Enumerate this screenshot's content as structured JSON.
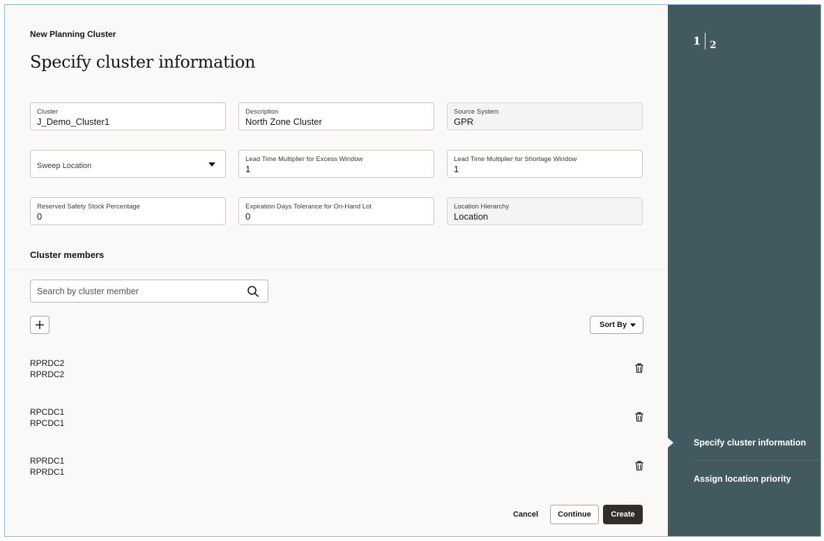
{
  "header": {
    "eyebrow": "New Planning Cluster",
    "title": "Specify cluster information"
  },
  "fields": {
    "cluster": {
      "label": "Cluster",
      "value": "J_Demo_Cluster1"
    },
    "description": {
      "label": "Description",
      "value": "North Zone Cluster"
    },
    "source_system": {
      "label": "Source System",
      "value": "GPR"
    },
    "sweep_location": {
      "placeholder": "Sweep Location"
    },
    "lead_excess": {
      "label": "Lead Time Multiplier for Excess Window",
      "value": "1"
    },
    "lead_shortage": {
      "label": "Lead Time Multiplier for Shortage Window",
      "value": "1"
    },
    "reserved_safety": {
      "label": "Reserved Safety Stock Percentage",
      "value": "0"
    },
    "expiration_tolerance": {
      "label": "Expiration Days Tolerance for On-Hand Lot",
      "value": "0"
    },
    "location_hierarchy": {
      "label": "Location Hierarchy",
      "value": "Location"
    }
  },
  "members": {
    "title": "Cluster members",
    "search_placeholder": "Search by cluster member",
    "sort_label": "Sort By",
    "items": [
      {
        "name": "RPRDC2",
        "description": "RPRDC2"
      },
      {
        "name": "RPCDC1",
        "description": "RPCDC1"
      },
      {
        "name": "RPRDC1",
        "description": "RPRDC1"
      }
    ]
  },
  "footer": {
    "cancel_label": "Cancel",
    "continue_label": "Continue",
    "create_label": "Create"
  },
  "train": {
    "current_step": "1",
    "total_steps": "2",
    "steps": [
      {
        "label": "Specify cluster information"
      },
      {
        "label": "Assign location priority"
      }
    ]
  },
  "colors": {
    "sidebar_bg": "#425a5f",
    "page_bg": "#fbf9f8",
    "primary_button": "#312d2a"
  },
  "icons": {
    "search": "search-icon",
    "add": "plus-icon",
    "delete": "trash-icon",
    "dropdown": "chevron-down-icon"
  }
}
